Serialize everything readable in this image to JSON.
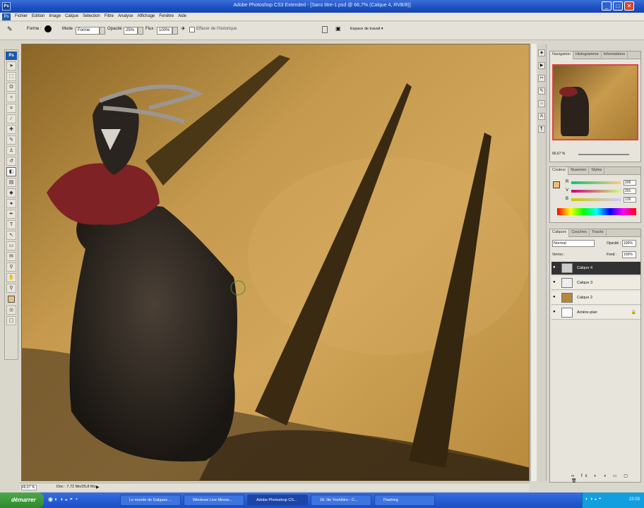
{
  "window": {
    "title": "Adobe Photoshop CS3 Extended - [Sans titre-1.psd @ 66,7% (Calque 4, RVB/8)]",
    "app_icon": "Ps"
  },
  "menu": [
    "Fichier",
    "Edition",
    "Image",
    "Calque",
    "Sélection",
    "Filtre",
    "Analyse",
    "Affichage",
    "Fenêtre",
    "Aide"
  ],
  "options": {
    "forme_label": "Forme :",
    "mode_label": "Mode :",
    "mode_value": "Forme",
    "opacite_label": "Opacité :",
    "opacite_value": "25%",
    "flux_label": "Flux :",
    "flux_value": "100%",
    "aerographe_label": "Effacer de l'historique",
    "workspace_label": "Espace de travail ▾"
  },
  "toolbox": {
    "ps_label": "Ps"
  },
  "status": {
    "zoom": "66,67 %",
    "doc": "Doc : 7,72 Mo/25,8 Mo"
  },
  "navigator": {
    "tabs": [
      "Navigation",
      "Histogramme",
      "Informations"
    ],
    "zoom": "66,67 %"
  },
  "color": {
    "tabs": [
      "Couleur",
      "Nuancier",
      "Styles"
    ],
    "r_label": "R",
    "g_label": "V",
    "b_label": "B",
    "r": "205",
    "g": "201",
    "b": "126",
    "fg_color": "#e8c074"
  },
  "layers": {
    "tabs": [
      "Calques",
      "Couches",
      "Tracés"
    ],
    "blend": "Normal",
    "opacite_label": "Opacité :",
    "opacite": "100%",
    "verrou_label": "Verrou :",
    "fond_label": "Fond :",
    "fond": "100%",
    "items": [
      {
        "name": "Calque 4",
        "selected": true
      },
      {
        "name": "Calque 3",
        "selected": false
      },
      {
        "name": "Calque 2",
        "selected": false
      },
      {
        "name": "Arrière-plan",
        "selected": false
      }
    ]
  },
  "taskbar": {
    "start": "démarrer",
    "items": [
      "Le monde de Galgaas ...",
      "Windows Live Messe...",
      "Adobe Photoshop CS...",
      "18. Ilie Yoshihiro - C...",
      "Flashing"
    ],
    "clock": "22:03"
  }
}
